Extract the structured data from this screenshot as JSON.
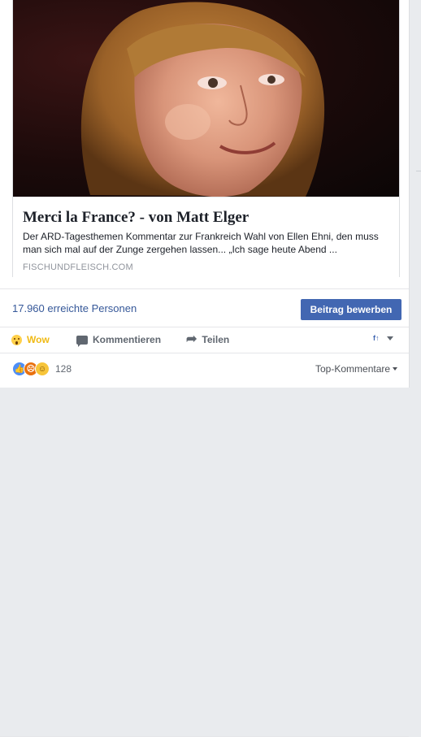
{
  "link": {
    "title": "Merci la France? - von Matt Elger",
    "description": "Der ARD-Tagesthemen Kommentar zur Frankreich Wahl von Ellen Ehni, den muss man sich mal auf der Zunge zergehen lassen... „Ich sage heute Abend ...",
    "domain": "FISCHUNDFLEISCH.COM"
  },
  "reach": {
    "text": "17.960 erreichte Personen",
    "boost_label": "Beitrag bewerben"
  },
  "actions": {
    "wow_label": "Wow",
    "comment_label": "Kommentieren",
    "share_label": "Teilen"
  },
  "reactions": {
    "count": "128",
    "sort_label": "Top-Kommentare"
  },
  "colors": {
    "link_blue": "#365899",
    "button_blue": "#4267b2",
    "wow_yellow": "#f0ba15"
  },
  "icons": {
    "wow": "wow-emoji-icon",
    "comment": "comment-bubble-icon",
    "share": "share-arrow-icon",
    "feed": "feed-selector-icon"
  }
}
